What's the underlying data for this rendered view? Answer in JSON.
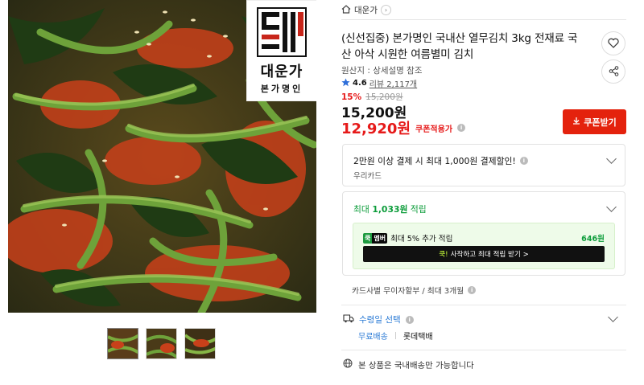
{
  "breadcrumb": {
    "label": "대운가"
  },
  "brand": {
    "name": "대운가",
    "subtitle": "본가명인",
    "mark_text": "대운",
    "mark_side": "본가명인"
  },
  "product": {
    "title": "(신선집중) 본가명인 국내산 열무김치 3kg 전재료 국산 아삭 시원한 여름별미 김치",
    "origin": "원산지 : 상세설명 참조",
    "rating": "4.6",
    "reviews": "리뷰 2,117개",
    "discount_rate": "15%",
    "original_price": "15,200원",
    "price": "15,200원",
    "coupon_price": "12,920원",
    "coupon_caption": "쿠폰적용가"
  },
  "coupon_button": {
    "label": "쿠폰받기"
  },
  "card_offer": {
    "title": "2만원 이상 결제 시 최대 1,000원 결제할인!",
    "card_name": "우리카드"
  },
  "reward": {
    "prefix": "최대 ",
    "amount": "1,033원",
    "suffix": " 적립",
    "member_badge_1": "쿡",
    "member_badge_2": "멤버",
    "member_text": "최대 5% 추가 적립",
    "member_amount": "646원",
    "member_cta_highlight": "쿡!",
    "member_cta": "사작하고 최대 적립 받기 >"
  },
  "installment": {
    "text": "카드사별 무이자할부 / 최대 3개월"
  },
  "shipping": {
    "label": "수령일 선택",
    "free_label": "무료배송",
    "carrier": "롯데택배"
  },
  "domestic": {
    "text": "본 상품은 국내배송만 가능합니다"
  },
  "colors": {
    "accent_red": "#e4220d",
    "green": "#0c9c3a",
    "blue": "#2a7ad5"
  },
  "icons": [
    "home-icon",
    "heart-icon",
    "share-icon",
    "download-icon",
    "info-icon",
    "chevron-down-icon",
    "truck-icon",
    "globe-icon",
    "star-icon"
  ]
}
